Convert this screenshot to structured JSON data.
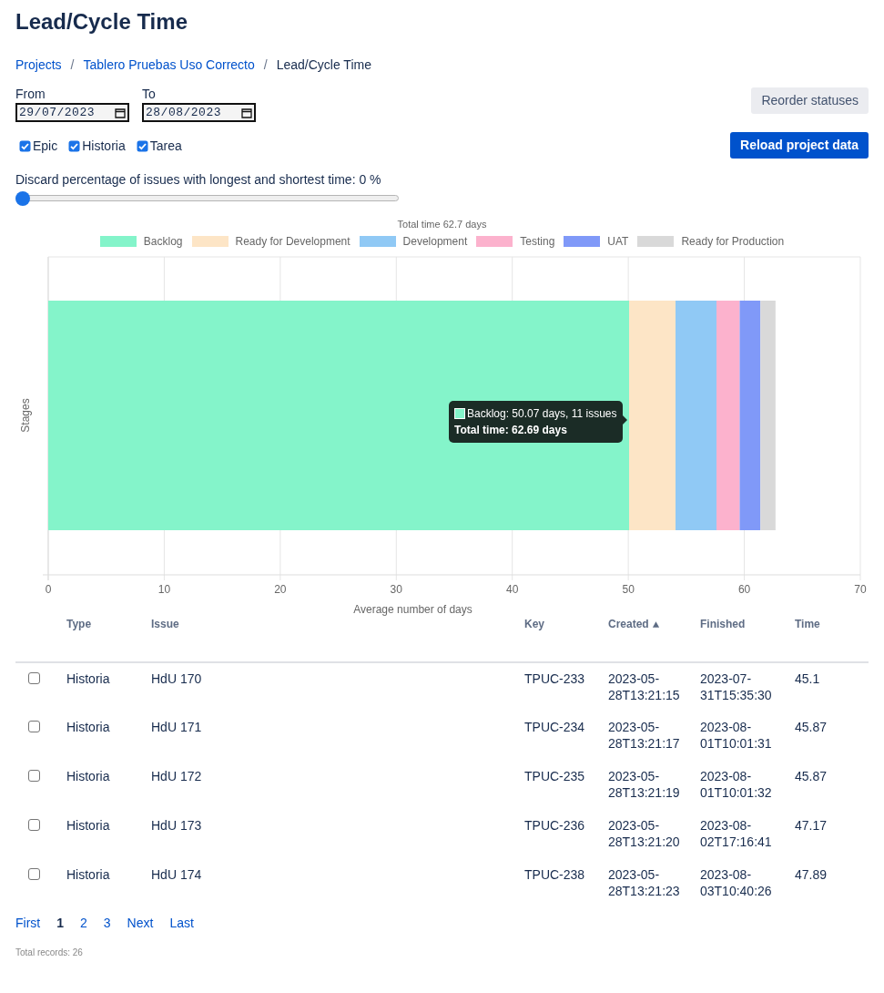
{
  "title": "Lead/Cycle Time",
  "breadcrumb": {
    "separator": "/",
    "items": [
      {
        "label": "Projects",
        "link": true
      },
      {
        "label": "Tablero Pruebas Uso Correcto",
        "link": true
      },
      {
        "label": "Lead/Cycle Time",
        "link": false
      }
    ]
  },
  "date_range": [
    {
      "label": "From",
      "value": "29/07/2023"
    },
    {
      "label": "To",
      "value": "28/08/2023"
    }
  ],
  "buttons": {
    "reorder": "Reorder statuses",
    "reload": "Reload project data"
  },
  "issue_types": [
    {
      "label": "Epic",
      "checked": true
    },
    {
      "label": "Historia",
      "checked": true
    },
    {
      "label": "Tarea",
      "checked": true
    }
  ],
  "discard": {
    "label": "Discard percentage of issues with longest and shortest time: 0 %",
    "level": 0
  },
  "chart": {
    "chart_data": {
      "type": "bar",
      "orientation": "horizontal",
      "stacked": true,
      "grid": true,
      "legend": true,
      "title": "Total time 62.7 days",
      "xlabel": "Average number of days",
      "ylabel": "Stages",
      "xlim": [
        0,
        70
      ],
      "xticks": [
        0,
        10,
        20,
        30,
        40,
        50,
        60,
        70
      ],
      "series": [
        {
          "name": "Backlog",
          "color": "#84f4ca",
          "values": [
            50.07
          ]
        },
        {
          "name": "Ready for Development",
          "color": "#fde5c6",
          "values": [
            4.0
          ]
        },
        {
          "name": "Development",
          "color": "#90c9f5",
          "values": [
            3.53
          ]
        },
        {
          "name": "Testing",
          "color": "#fcb2cd",
          "values": [
            2.0
          ]
        },
        {
          "name": "UAT",
          "color": "#8099f8",
          "values": [
            1.79
          ]
        },
        {
          "name": "Ready for Production",
          "color": "#d9d9d9",
          "values": [
            1.3
          ]
        }
      ]
    },
    "tooltip": {
      "label": "Backlog: 50.07 days, 11 issues",
      "total": "Total time: 62.69 days"
    }
  },
  "table": {
    "columns": [
      {
        "label": "Type"
      },
      {
        "label": "Issue"
      },
      {
        "label": "Key"
      },
      {
        "label": "Created",
        "sorted_ascending": true
      },
      {
        "label": "Finished"
      },
      {
        "label": "Time"
      }
    ],
    "rows": [
      {
        "selected": false,
        "cells": [
          "Historia",
          "HdU 170",
          "TPUC-233",
          "2023-05-28T13:21:15",
          "2023-07-31T15:35:30",
          "45.1"
        ]
      },
      {
        "selected": false,
        "cells": [
          "Historia",
          "HdU 171",
          "TPUC-234",
          "2023-05-28T13:21:17",
          "2023-08-01T10:01:31",
          "45.87"
        ]
      },
      {
        "selected": false,
        "cells": [
          "Historia",
          "HdU 172",
          "TPUC-235",
          "2023-05-28T13:21:19",
          "2023-08-01T10:01:32",
          "45.87"
        ]
      },
      {
        "selected": false,
        "cells": [
          "Historia",
          "HdU 173",
          "TPUC-236",
          "2023-05-28T13:21:20",
          "2023-08-02T17:16:41",
          "47.17"
        ]
      },
      {
        "selected": false,
        "cells": [
          "Historia",
          "HdU 174",
          "TPUC-238",
          "2023-05-28T13:21:23",
          "2023-08-03T10:40:26",
          "47.89"
        ]
      }
    ]
  },
  "pagination": [
    {
      "label": "First",
      "selected": false
    },
    {
      "label": "1",
      "selected": true
    },
    {
      "label": "2",
      "selected": false
    },
    {
      "label": "3",
      "selected": false
    },
    {
      "label": "Next",
      "selected": false
    },
    {
      "label": "Last",
      "selected": false
    }
  ],
  "total_records": "Total records: 26"
}
